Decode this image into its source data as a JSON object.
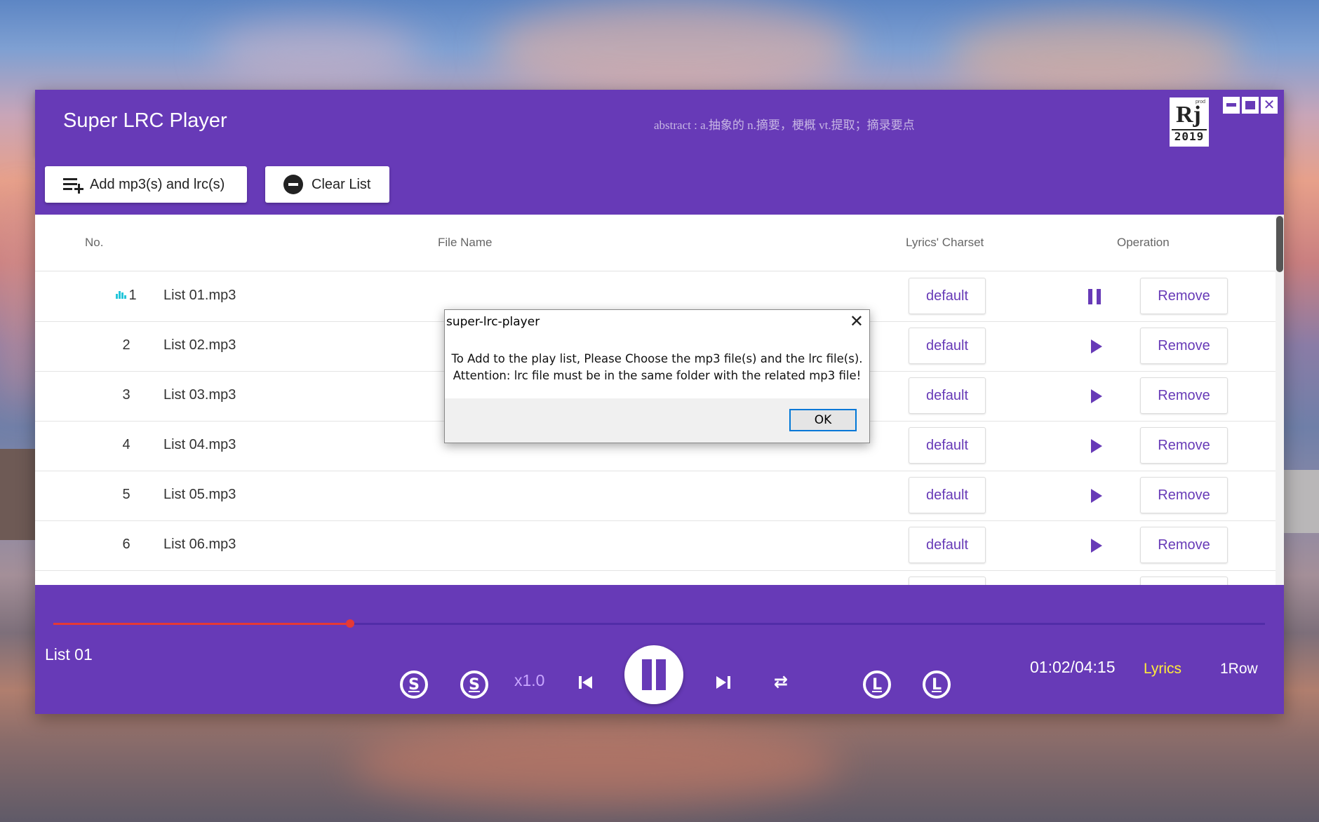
{
  "window": {
    "title": "Super LRC Player",
    "marquee": "abstract : a.抽象的 n.摘要，梗概 vt.提取；摘录要点",
    "logo": {
      "mark": "Rj",
      "tag": "prod",
      "year": "2019"
    },
    "controls": {
      "minimize_icon": "minimize-icon",
      "maximize_icon": "maximize-icon",
      "close_glyph": "✕"
    }
  },
  "toolbar": {
    "add_label": "Add mp3(s) and lrc(s)",
    "clear_label": "Clear List"
  },
  "table": {
    "headers": {
      "no": "No.",
      "file_name": "File Name",
      "charset": "Lyrics' Charset",
      "operation": "Operation"
    },
    "rows": [
      {
        "no": "1",
        "name": "List 01.mp3",
        "charset": "default",
        "remove": "Remove",
        "state": "playing"
      },
      {
        "no": "2",
        "name": "List 02.mp3",
        "charset": "default",
        "remove": "Remove",
        "state": "stopped"
      },
      {
        "no": "3",
        "name": "List 03.mp3",
        "charset": "default",
        "remove": "Remove",
        "state": "stopped"
      },
      {
        "no": "4",
        "name": "List 04.mp3",
        "charset": "default",
        "remove": "Remove",
        "state": "stopped"
      },
      {
        "no": "5",
        "name": "List 05.mp3",
        "charset": "default",
        "remove": "Remove",
        "state": "stopped"
      },
      {
        "no": "6",
        "name": "List 06.mp3",
        "charset": "default",
        "remove": "Remove",
        "state": "stopped"
      }
    ]
  },
  "player": {
    "now_playing": "List 01",
    "progress_fraction": 0.245,
    "speed": "x1.0",
    "time": "01:02/04:15",
    "lyrics_label": "Lyrics",
    "row_label": "1Row",
    "s_glyph": "S",
    "l_glyph": "L",
    "repeat_glyph": "⇄"
  },
  "dialog": {
    "title": "super-lrc-player",
    "close_glyph": "✕",
    "line1": "To Add to the play list, Please Choose the mp3 file(s) and the lrc file(s).",
    "line2": "Attention: lrc file must be in the same folder with the related mp3 file!",
    "ok_label": "OK"
  },
  "colors": {
    "primary": "#673ab7",
    "progress": "#e53935",
    "lyrics": "#ffeb3b",
    "speed": "#c9a7ff",
    "playing_indicator": "#26c6da"
  }
}
